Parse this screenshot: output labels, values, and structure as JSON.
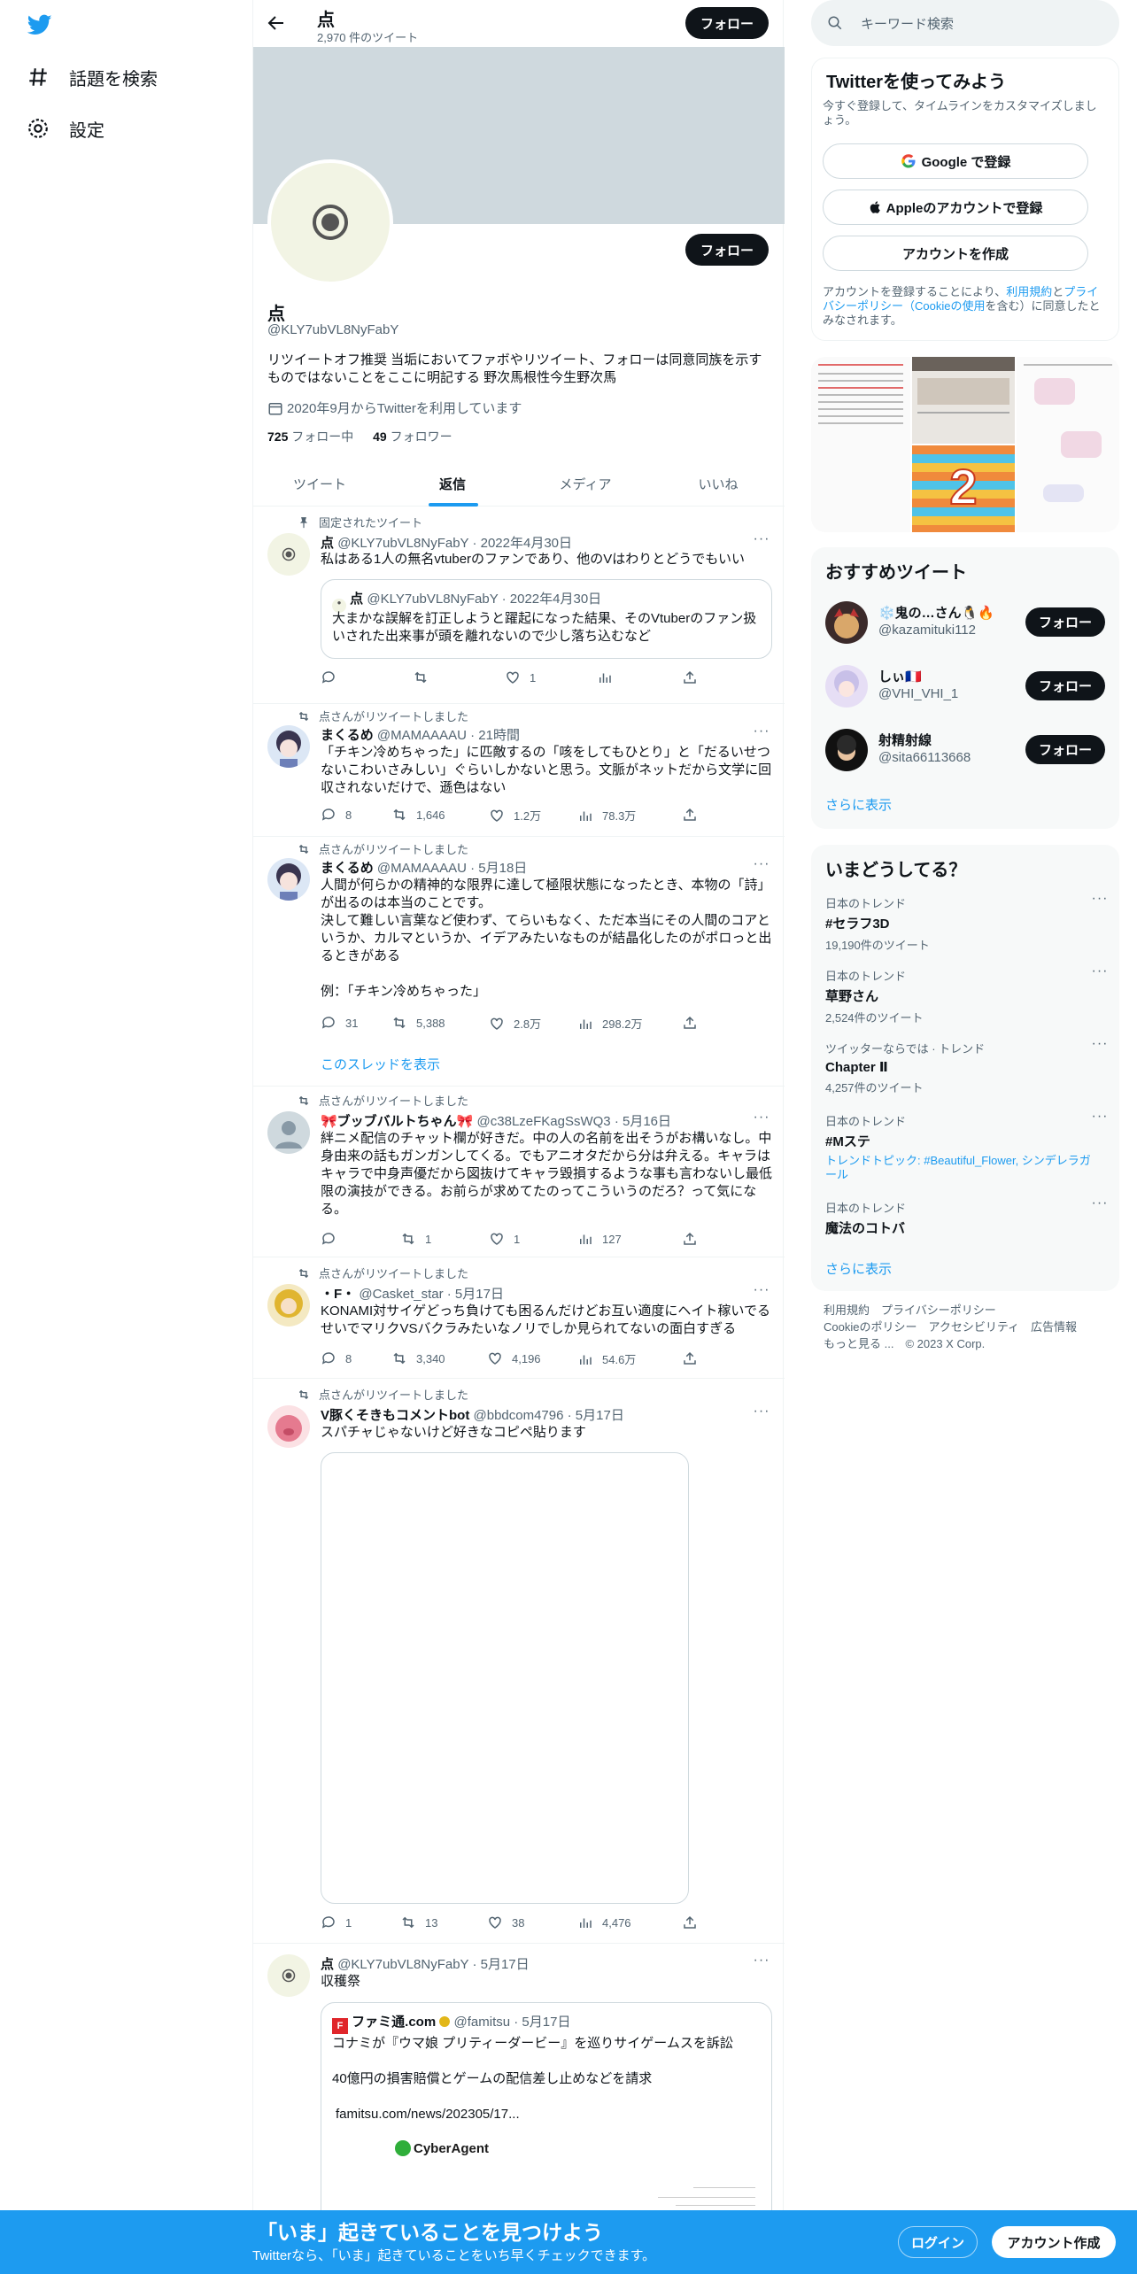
{
  "nav": {
    "explore_label": "話題を検索",
    "settings_label": "設定"
  },
  "header": {
    "title": "点",
    "tweet_count": "2,970 件のツイート",
    "follow_label": "フォロー"
  },
  "profile": {
    "name": "点",
    "handle": "@KLY7ubVL8NyFabY",
    "bio": "リツイートオフ推奨 当垢においてファボやリツイート、フォローは同意同族を示すものではないことをここに明記する 野次馬根性今生野次馬",
    "joined": "2020年9月からTwitterを利用しています",
    "following_count": "725",
    "following_label": "フォロー中",
    "followers_count": "49",
    "followers_label": "フォロワー",
    "follow_label": "フォロー"
  },
  "tabs": [
    "ツイート",
    "返信",
    "メディア",
    "いいね"
  ],
  "active_tab": "返信",
  "tweets": [
    {
      "context": "固定されたツイート",
      "name": "点",
      "meta": "@KLY7ubVL8NyFabY · 2022年4月30日",
      "text": "私はある1人の無名vtuberのファンであり、他のVはわりとどうでもいい",
      "quote_name": "点",
      "quote_meta": "@KLY7ubVL8NyFabY · 2022年4月30日",
      "quote_text": "大まかな誤解を訂正しようと躍起になった結果、そのVtuberのファン扱いされた出来事が頭を離れないので少し落ち込むなど",
      "replies": "",
      "retweets": "",
      "likes": "1",
      "views": ""
    },
    {
      "context": "点さんがリツイートしました",
      "name": "まくるめ",
      "meta": "@MAMAAAAU · 21時間",
      "text": "「チキン冷めちゃった」に匹敵するの「咳をしてもひとり」と「だるいせつないこわいさみしい」ぐらいしかないと思う。文脈がネットだから文学に回収されないだけで、遜色はない",
      "replies": "8",
      "retweets": "1,646",
      "likes": "1.2万",
      "views": "78.3万"
    },
    {
      "context": "点さんがリツイートしました",
      "name": "まくるめ",
      "meta": "@MAMAAAAU · 5月18日",
      "text": "人間が何らかの精神的な限界に達して極限状態になったとき、本物の「詩」が出るのは本当のことです。\n決して難しい言葉など使わず、てらいもなく、ただ本当にその人間のコアというか、カルマというか、イデアみたいなものが結晶化したのがポロっと出るときがある\n\n例：「チキン冷めちゃった」",
      "replies": "31",
      "retweets": "5,388",
      "likes": "2.8万",
      "views": "298.2万",
      "show_thread": "このスレッドを表示"
    },
    {
      "context": "点さんがリツイートしました",
      "name": "🎀ブッブバルトちゃん🎀",
      "meta": "@c38LzeFKagSsWQ3 · 5月16日",
      "text": "絆ニメ配信のチャット欄が好きだ。中の人の名前を出そうがお構いなし。中身由来の話もガンガンしてくる。でもアニオタだから分は弁える。キャラはキャラで中身声優だから図抜けてキャラ毀損するような事も言わないし最低限の演技ができる。お前らが求めてたのってこういうのだろ？って気になる。",
      "replies": "",
      "retweets": "1",
      "likes": "1",
      "views": "127"
    },
    {
      "context": "点さんがリツイートしました",
      "name": "・F・",
      "meta": "@Casket_star · 5月17日",
      "text": "KONAMI対サイゲどっち負けても困るんだけどお互い適度にヘイト稼いでるせいでマリクVSバクラみたいなノリでしか見られてないの面白すぎる",
      "replies": "8",
      "retweets": "3,340",
      "likes": "4,196",
      "views": "54.6万"
    },
    {
      "context": "点さんがリツイートしました",
      "name": "V豚くそきもコメントbot",
      "meta": "@bbdcom4796 · 5月17日",
      "text": "スパチャじゃないけど好きなコピペ貼ります",
      "replies": "1",
      "retweets": "13",
      "likes": "38",
      "views": "4,476"
    },
    {
      "name": "点",
      "meta": "@KLY7ubVL8NyFabY · 5月17日",
      "text": "収穫祭",
      "quote_name": "ファミ通.com",
      "quote_meta": "@famitsu · 5月17日",
      "quote_text": "コナミが『ウマ娘 プリティーダービー』を巡りサイゲームスを訴訟",
      "quote_text2": "40億円の損害賠償とゲームの配信差し止めなどを請求",
      "quote_link": "famitsu.com/news/202305/17...",
      "cyberagent": "CyberAgent"
    }
  ],
  "right": {
    "search_placeholder": "キーワード検索",
    "signup": {
      "title": "Twitterを使ってみよう",
      "subtitle": "今すぐ登録して、タイムラインをカスタマイズしましょう。",
      "google": "Google で登録",
      "apple": "Appleのアカウントで登録",
      "create": "アカウントを作成",
      "terms_pre": "アカウントを登録することにより、",
      "terms_link1": "利用規約",
      "terms_and": "と",
      "terms_link2": "プライバシーポリシー（Cookieの使用",
      "terms_post": "を含む）に同意したとみなされます。"
    },
    "who_to_follow": {
      "title": "おすすめツイート",
      "users": [
        {
          "name": "❄️鬼の…さん🐧🔥",
          "handle": "@kazamituki112",
          "button": "フォロー"
        },
        {
          "name": "しぃ🇲🇫",
          "handle": "@VHI_VHI_1",
          "button": "フォロー"
        },
        {
          "name": "射精射線",
          "handle": "@sita66113668",
          "button": "フォロー"
        }
      ],
      "show_more": "さらに表示"
    },
    "trends": {
      "title": "いまどうしてる？",
      "items": [
        {
          "category": "日本のトレンド",
          "name": "#セラフ3D",
          "count": "19,190件のツイート"
        },
        {
          "category": "日本のトレンド",
          "name": "草野さん",
          "count": "2,524件のツイート"
        },
        {
          "category": "ツイッターならでは · トレンド",
          "name": "Chapter Ⅱ",
          "count": "4,257件のツイート"
        },
        {
          "category": "日本のトレンド",
          "name": "#Mステ",
          "count": "トレンドトピック: #Beautiful_Flower, シンデレラガール"
        },
        {
          "category": "日本のトレンド",
          "name": "魔法のコトバ",
          "count": ""
        }
      ],
      "show_more": "さらに表示"
    },
    "footer": {
      "line1": "利用規約　プライバシーポリシー",
      "line2": "Cookieのポリシー　アクセシビリティ　広告情報",
      "line3": "もっと見る ...　© 2023 X Corp."
    },
    "media_number": "2"
  },
  "bottom": {
    "title": "「いま」起きていることを見つけよう",
    "subtitle": "Twitterなら、「いま」起きていることをいち早くチェックできます。",
    "login": "ログイン",
    "signup": "アカウント作成"
  },
  "colors": {
    "accent": "#1d9bf0",
    "dark": "#0f1419",
    "muted": "#536471",
    "border": "#eff3f4",
    "banner": "#cfd9de"
  }
}
